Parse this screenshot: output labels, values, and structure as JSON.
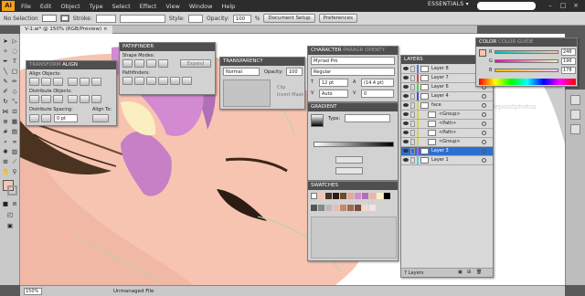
{
  "menubar": {
    "app_logo": "Ai",
    "items": [
      "File",
      "Edit",
      "Object",
      "Type",
      "Select",
      "Effect",
      "View",
      "Window",
      "Help"
    ],
    "workspace": "ESSENTIALS ▾"
  },
  "control": {
    "selection": "No Selection",
    "stroke_label": "Stroke:",
    "style_label": "Style:",
    "opacity_label": "Opacity:",
    "opacity_value": "100",
    "opacity_unit": "%",
    "doc_setup": "Document Setup",
    "preferences": "Preferences"
  },
  "document": {
    "tab_title": "V-1.ai* @ 150% (RGB/Preview)",
    "tab_close": "×"
  },
  "status": {
    "zoom": "150%",
    "info": "Unmanaged File"
  },
  "transform_panel": {
    "tabs": "TRANSFORM",
    "tab_active": "ALIGN",
    "align_objects": "Align Objects:",
    "distribute_objects": "Distribute Objects:",
    "distribute_spacing": "Distribute Spacing:",
    "align_to": "Align To:",
    "spacing_value": "0 pt"
  },
  "pathfinder_panel": {
    "title": "PATHFINDER",
    "shape_modes": "Shape Modes:",
    "pathfinders": "Pathfinders:",
    "expand": "Expand"
  },
  "transparency_panel": {
    "title": "TRANSPARENCY",
    "blend_mode": "Normal",
    "opacity_label": "Opacity:",
    "opacity_value": "100",
    "clip": "Clip",
    "invert_mask": "Invert Mask"
  },
  "character_panel": {
    "tab_active": "CHARACTER",
    "tab_other": "PARAGR OPENTY",
    "font": "Myriad Pro",
    "style": "Regular",
    "size": "12 pt",
    "leading": "(14.4 pt)",
    "kerning": "Auto",
    "tracking": "0"
  },
  "gradient_panel": {
    "title": "GRADIENT",
    "type_label": "Type:"
  },
  "swatches_panel": {
    "title": "SWATCHES"
  },
  "layers_panel": {
    "title": "LAYERS",
    "rows": [
      {
        "name": "Layer 8",
        "color": "#4a7bd6"
      },
      {
        "name": "Layer 7",
        "color": "#d64a4a"
      },
      {
        "name": "Layer 6",
        "color": "#4ad64a"
      },
      {
        "name": "Layer 4",
        "color": "#4a4ad6"
      },
      {
        "name": "face",
        "color": "#d6d64a"
      },
      {
        "name": "<Group>",
        "color": "#d6d64a"
      },
      {
        "name": "<Path>",
        "color": "#d6d64a"
      },
      {
        "name": "<Path>",
        "color": "#d6d64a"
      },
      {
        "name": "<Group>",
        "color": "#d6d64a"
      },
      {
        "name": "Layer 3",
        "color": "#d64ad6"
      },
      {
        "name": "Layer 1",
        "color": "#4ad6d6"
      }
    ],
    "selected_index": 9,
    "footer": "7 Layers"
  },
  "color_panel": {
    "tab_active": "COLOR",
    "tab_other": "COLOR GUIDE",
    "channels": [
      {
        "label": "R",
        "value": "246"
      },
      {
        "label": "G",
        "value": "196"
      },
      {
        "label": "B",
        "value": "178"
      }
    ]
  },
  "colors": {
    "skin": "#f7c4b2",
    "skin_shadow": "#f0b5a2",
    "petal": "#d38ad0",
    "petal_dark": "#b070b8",
    "hair": "#4a3421",
    "accent_fill": "#f6c4b2"
  },
  "watermark": "depositphotos"
}
